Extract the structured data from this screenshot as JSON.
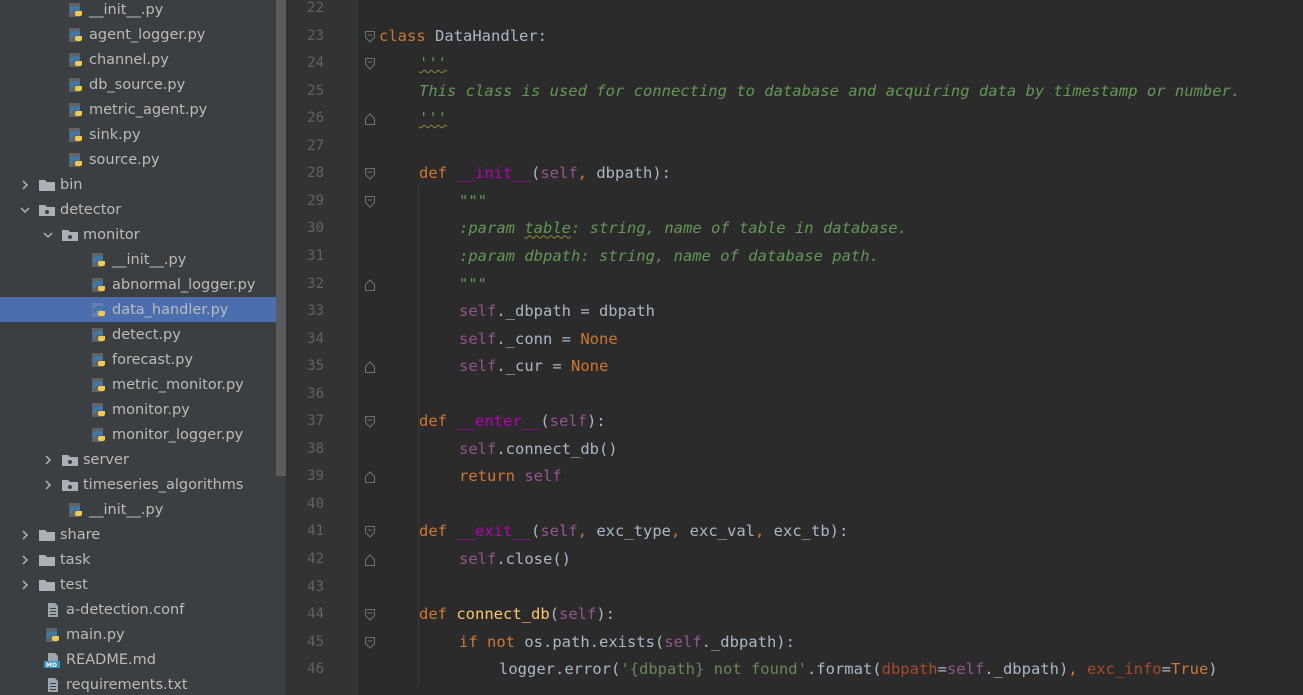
{
  "project_tree": {
    "rows": [
      {
        "label": "__init__.py",
        "depth": 2,
        "kind": "py",
        "arrow": "none"
      },
      {
        "label": "agent_logger.py",
        "depth": 2,
        "kind": "py",
        "arrow": "none"
      },
      {
        "label": "channel.py",
        "depth": 2,
        "kind": "py",
        "arrow": "none"
      },
      {
        "label": "db_source.py",
        "depth": 2,
        "kind": "py",
        "arrow": "none"
      },
      {
        "label": "metric_agent.py",
        "depth": 2,
        "kind": "py",
        "arrow": "none"
      },
      {
        "label": "sink.py",
        "depth": 2,
        "kind": "py",
        "arrow": "none"
      },
      {
        "label": "source.py",
        "depth": 2,
        "kind": "py",
        "arrow": "none"
      },
      {
        "label": "bin",
        "depth": 1,
        "kind": "folder",
        "arrow": "collapsed"
      },
      {
        "label": "detector",
        "depth": 1,
        "kind": "package",
        "arrow": "expanded"
      },
      {
        "label": "monitor",
        "depth": 2,
        "kind": "package",
        "arrow": "expanded"
      },
      {
        "label": "__init__.py",
        "depth": 3,
        "kind": "py",
        "arrow": "none"
      },
      {
        "label": "abnormal_logger.py",
        "depth": 3,
        "kind": "py",
        "arrow": "none"
      },
      {
        "label": "data_handler.py",
        "depth": 3,
        "kind": "py",
        "arrow": "none",
        "selected": true
      },
      {
        "label": "detect.py",
        "depth": 3,
        "kind": "py",
        "arrow": "none"
      },
      {
        "label": "forecast.py",
        "depth": 3,
        "kind": "py",
        "arrow": "none"
      },
      {
        "label": "metric_monitor.py",
        "depth": 3,
        "kind": "py",
        "arrow": "none"
      },
      {
        "label": "monitor.py",
        "depth": 3,
        "kind": "py",
        "arrow": "none"
      },
      {
        "label": "monitor_logger.py",
        "depth": 3,
        "kind": "py",
        "arrow": "none"
      },
      {
        "label": "server",
        "depth": 2,
        "kind": "package",
        "arrow": "collapsed"
      },
      {
        "label": "timeseries_algorithms",
        "depth": 2,
        "kind": "package",
        "arrow": "collapsed"
      },
      {
        "label": "__init__.py",
        "depth": 2,
        "kind": "py",
        "arrow": "none"
      },
      {
        "label": "share",
        "depth": 1,
        "kind": "folder",
        "arrow": "collapsed"
      },
      {
        "label": "task",
        "depth": 1,
        "kind": "folder",
        "arrow": "collapsed"
      },
      {
        "label": "test",
        "depth": 1,
        "kind": "folder",
        "arrow": "collapsed"
      },
      {
        "label": "a-detection.conf",
        "depth": 1,
        "kind": "text",
        "arrow": "none"
      },
      {
        "label": "main.py",
        "depth": 1,
        "kind": "py",
        "arrow": "none"
      },
      {
        "label": "README.md",
        "depth": 1,
        "kind": "md",
        "arrow": "none"
      },
      {
        "label": "requirements.txt",
        "depth": 1,
        "kind": "text",
        "arrow": "none"
      },
      {
        "label": "",
        "depth": 1,
        "kind": "text",
        "arrow": "none"
      }
    ]
  },
  "editor": {
    "lines": [
      {
        "n": "22",
        "indent": 0,
        "fold": "none",
        "tokens": []
      },
      {
        "n": "23",
        "indent": 0,
        "fold": "open",
        "tokens": [
          [
            "kw",
            "class "
          ],
          [
            "cls",
            "DataHandler:"
          ]
        ]
      },
      {
        "n": "24",
        "indent": 1,
        "fold": "open",
        "tokens": [
          [
            "doc typo",
            "'''"
          ]
        ]
      },
      {
        "n": "25",
        "indent": 1,
        "fold": "none",
        "tokens": [
          [
            "doc",
            "This class is used for connecting to database and acquiring data by timestamp or number."
          ]
        ]
      },
      {
        "n": "26",
        "indent": 1,
        "fold": "end",
        "tokens": [
          [
            "doc typo",
            "'''"
          ]
        ]
      },
      {
        "n": "27",
        "indent": 0,
        "fold": "none",
        "tokens": []
      },
      {
        "n": "28",
        "indent": 1,
        "fold": "open",
        "tokens": [
          [
            "kw",
            "def "
          ],
          [
            "dunder",
            "__init__"
          ],
          [
            "",
            "("
          ],
          [
            "self",
            "self"
          ],
          [
            "kw",
            ", "
          ],
          [
            "",
            "dbpath):"
          ]
        ]
      },
      {
        "n": "29",
        "indent": 2,
        "fold": "open",
        "tokens": [
          [
            "doc",
            "\"\"\""
          ]
        ]
      },
      {
        "n": "30",
        "indent": 2,
        "fold": "none",
        "tokens": [
          [
            "doc",
            ":param "
          ],
          [
            "doc typo",
            "table"
          ],
          [
            "doc",
            ": string, name of table in database."
          ]
        ]
      },
      {
        "n": "31",
        "indent": 2,
        "fold": "none",
        "tokens": [
          [
            "doc",
            ":param dbpath: string, name of database path."
          ]
        ]
      },
      {
        "n": "32",
        "indent": 2,
        "fold": "end",
        "tokens": [
          [
            "doc",
            "\"\"\""
          ]
        ]
      },
      {
        "n": "33",
        "indent": 2,
        "fold": "none",
        "tokens": [
          [
            "self",
            "self"
          ],
          [
            "",
            "._dbpath = dbpath"
          ]
        ]
      },
      {
        "n": "34",
        "indent": 2,
        "fold": "none",
        "tokens": [
          [
            "self",
            "self"
          ],
          [
            "",
            "._conn = "
          ],
          [
            "kw",
            "None"
          ]
        ]
      },
      {
        "n": "35",
        "indent": 2,
        "fold": "end",
        "tokens": [
          [
            "self",
            "self"
          ],
          [
            "",
            "._cur = "
          ],
          [
            "kw",
            "None"
          ]
        ]
      },
      {
        "n": "36",
        "indent": 0,
        "fold": "none",
        "tokens": []
      },
      {
        "n": "37",
        "indent": 1,
        "fold": "open",
        "tokens": [
          [
            "kw",
            "def "
          ],
          [
            "dunder",
            "__enter__"
          ],
          [
            "",
            "("
          ],
          [
            "self",
            "self"
          ],
          [
            "",
            "):"
          ]
        ]
      },
      {
        "n": "38",
        "indent": 2,
        "fold": "none",
        "tokens": [
          [
            "self",
            "self"
          ],
          [
            "",
            ".connect_db()"
          ]
        ]
      },
      {
        "n": "39",
        "indent": 2,
        "fold": "end",
        "tokens": [
          [
            "kw",
            "return "
          ],
          [
            "self",
            "self"
          ]
        ]
      },
      {
        "n": "40",
        "indent": 0,
        "fold": "none",
        "tokens": []
      },
      {
        "n": "41",
        "indent": 1,
        "fold": "open",
        "tokens": [
          [
            "kw",
            "def "
          ],
          [
            "dunder",
            "__exit__"
          ],
          [
            "",
            "("
          ],
          [
            "self",
            "self"
          ],
          [
            "kw",
            ", "
          ],
          [
            "",
            "exc_type"
          ],
          [
            "kw",
            ", "
          ],
          [
            "",
            "exc_val"
          ],
          [
            "kw",
            ", "
          ],
          [
            "",
            "exc_tb):"
          ]
        ]
      },
      {
        "n": "42",
        "indent": 2,
        "fold": "end",
        "tokens": [
          [
            "self",
            "self"
          ],
          [
            "",
            ".close()"
          ]
        ]
      },
      {
        "n": "43",
        "indent": 0,
        "fold": "none",
        "tokens": []
      },
      {
        "n": "44",
        "indent": 1,
        "fold": "open",
        "tokens": [
          [
            "kw",
            "def "
          ],
          [
            "fn",
            "connect_db"
          ],
          [
            "",
            "("
          ],
          [
            "self",
            "self"
          ],
          [
            "",
            "):"
          ]
        ]
      },
      {
        "n": "45",
        "indent": 2,
        "fold": "open",
        "tokens": [
          [
            "kw",
            "if not "
          ],
          [
            "",
            "os.path.exists("
          ],
          [
            "self",
            "self"
          ],
          [
            "",
            "._dbpath):"
          ]
        ]
      },
      {
        "n": "46",
        "indent": 3,
        "fold": "none",
        "tokens": [
          [
            "",
            "logger.error("
          ],
          [
            "str",
            "'{dbpath} not found'"
          ],
          [
            "",
            ".format("
          ],
          [
            "param",
            "dbpath"
          ],
          [
            "",
            "="
          ],
          [
            "self",
            "self"
          ],
          [
            "",
            "._dbpath)"
          ],
          [
            "kw",
            ", "
          ],
          [
            "param",
            "exc_info"
          ],
          [
            "",
            "="
          ],
          [
            "kw",
            "True"
          ],
          [
            "",
            ")"
          ]
        ]
      }
    ]
  },
  "colors": {
    "selection": "#4b6eaf",
    "python_blue": "#3c78aa",
    "python_yellow": "#f2c94c",
    "folder": "#a9b0b7"
  }
}
